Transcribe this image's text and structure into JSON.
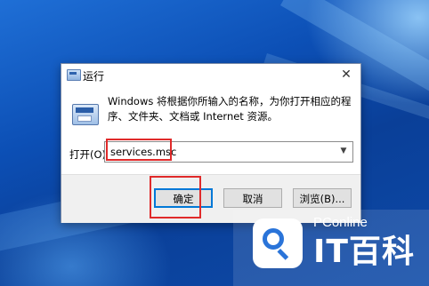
{
  "dialog": {
    "title": "运行",
    "description": "Windows 将根据你所输入的名称，为你打开相应的程序、文件夹、文档或 Internet 资源。",
    "open_label": "打开(O):",
    "input_value": "services.msc",
    "buttons": {
      "ok": "确定",
      "cancel": "取消",
      "browse": "浏览(B)..."
    },
    "highlight_color": "#e02a2a"
  },
  "watermark": {
    "brand": "PConline",
    "name": "IT百科"
  },
  "icons": [
    "run-dialog-icon",
    "close-icon",
    "run-app-icon",
    "chevron-down-icon",
    "pconline-logo-icon"
  ],
  "colors": {
    "desktop": "#0c4fb5",
    "accent": "#0078d7",
    "logo_blue": "#2a74d9"
  }
}
